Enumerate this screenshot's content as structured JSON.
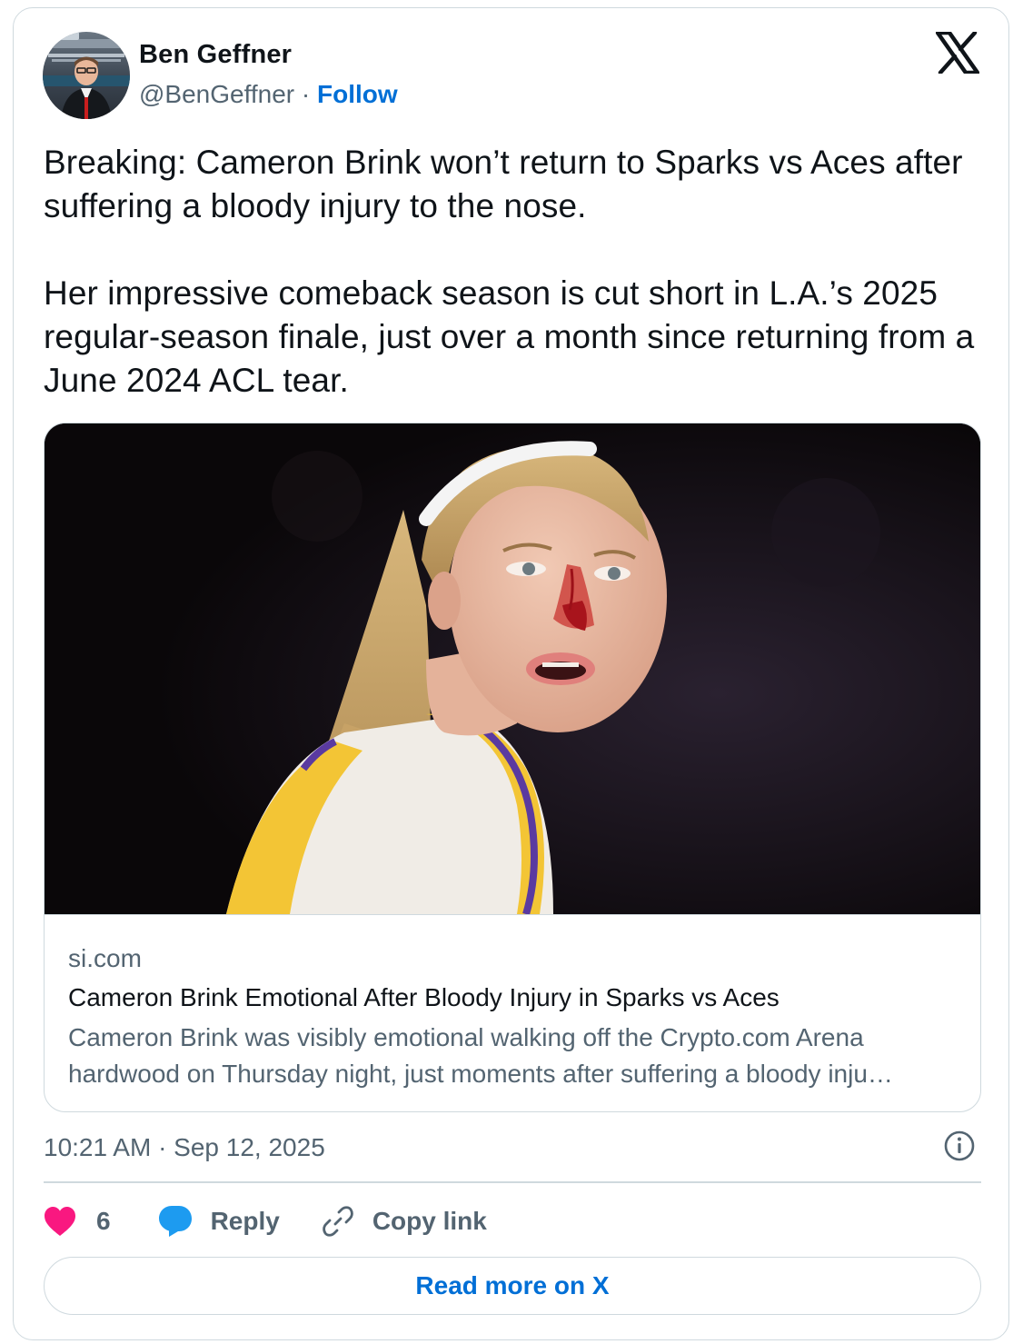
{
  "author": {
    "name": "Ben Geffner",
    "handle": "@BenGeffner",
    "separator": " · ",
    "follow_label": "Follow"
  },
  "tweet": {
    "text": "Breaking: Cameron Brink won’t return to Sparks vs Aces after suffering a bloody injury to the nose.\n\nHer impressive comeback season is cut short in L.A.’s 2025 regular-season finale, just over a month since returning from a June 2024 ACL tear."
  },
  "link_card": {
    "domain": "si.com",
    "title": "Cameron Brink Emotional After Bloody Injury in Sparks vs Aces",
    "description": "Cameron Brink was visibly emotional walking off the Crypto.com Arena hardwood on Thursday night, just moments after suffering a bloody inju…"
  },
  "timestamp": "10:21 AM · Sep 12, 2025",
  "actions": {
    "like_count": "6",
    "reply_label": "Reply",
    "copy_label": "Copy link"
  },
  "read_more_label": "Read more on X",
  "colors": {
    "accent": "#006fd6",
    "like": "#f91880",
    "reply_icon": "#1d9bf0",
    "border": "#cfd9de",
    "secondary_text": "#536471"
  },
  "icons": [
    "x-logo-icon",
    "info-icon",
    "heart-icon",
    "reply-bubble-icon",
    "link-icon"
  ]
}
